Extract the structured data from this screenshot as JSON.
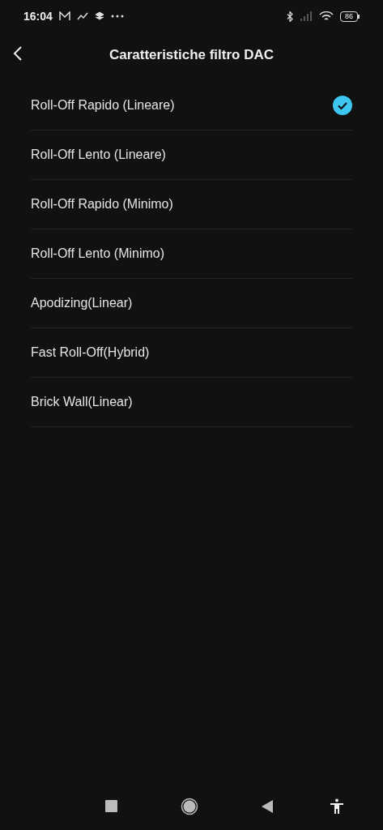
{
  "status_bar": {
    "time": "16:04",
    "battery": "86"
  },
  "header": {
    "title": "Caratteristiche filtro DAC"
  },
  "options": [
    {
      "label": "Roll-Off Rapido (Lineare)",
      "selected": true
    },
    {
      "label": "Roll-Off Lento (Lineare)",
      "selected": false
    },
    {
      "label": "Roll-Off Rapido (Minimo)",
      "selected": false
    },
    {
      "label": "Roll-Off Lento (Minimo)",
      "selected": false
    },
    {
      "label": "Apodizing(Linear)",
      "selected": false
    },
    {
      "label": "Fast Roll-Off(Hybrid)",
      "selected": false
    },
    {
      "label": "Brick Wall(Linear)",
      "selected": false
    }
  ]
}
